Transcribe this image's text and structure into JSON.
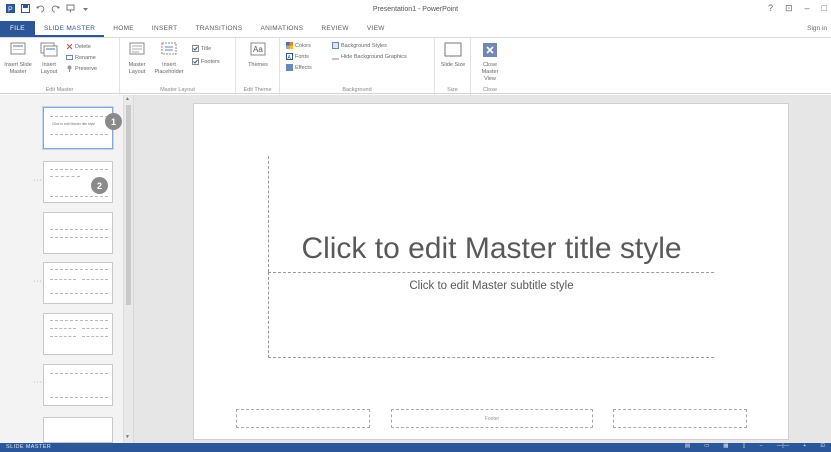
{
  "window": {
    "title": "Presentation1 - PowerPoint",
    "controls": [
      "?",
      "⊡",
      "–",
      "□"
    ]
  },
  "qat": {
    "icons": [
      "powerpoint-logo-icon",
      "save-icon",
      "undo-icon",
      "redo-icon",
      "start-from-beginning-icon",
      "customize-qat-icon"
    ]
  },
  "tabs": {
    "file": "FILE",
    "items": [
      "SLIDE MASTER",
      "HOME",
      "INSERT",
      "TRANSITIONS",
      "ANIMATIONS",
      "REVIEW",
      "VIEW"
    ],
    "active": "SLIDE MASTER",
    "signin": "Sign in"
  },
  "ribbon": {
    "edit_master": {
      "label": "Edit Master",
      "insert_slide_master": "Insert Slide Master",
      "insert_layout": "Insert Layout",
      "delete": "Delete",
      "rename": "Rename",
      "preserve": "Preserve"
    },
    "master_layout": {
      "label": "Master Layout",
      "master_layout": "Master Layout",
      "insert_placeholder": "Insert Placeholder",
      "title": "Title",
      "footers": "Footers"
    },
    "edit_theme": {
      "label": "Edit Theme",
      "themes": "Themes"
    },
    "background": {
      "label": "Background",
      "colors": "Colors",
      "fonts": "Fonts",
      "effects": "Effects",
      "background_styles": "Background Styles",
      "hide_background_graphics": "Hide Background Graphics"
    },
    "size": {
      "label": "Size",
      "slide_size": "Slide Size"
    },
    "close": {
      "label": "Close",
      "close_master_view": "Close Master View"
    }
  },
  "slide_panel": {
    "thumbnails": [
      {
        "index": 1,
        "selected": true,
        "callout": "1"
      },
      {
        "index": 2,
        "selected": false,
        "callout": "2"
      },
      {
        "index": 3,
        "selected": false,
        "callout": ""
      },
      {
        "index": 4,
        "selected": false,
        "callout": ""
      },
      {
        "index": 5,
        "selected": false,
        "callout": ""
      },
      {
        "index": 6,
        "selected": false,
        "callout": ""
      },
      {
        "index": 7,
        "selected": false,
        "callout": ""
      }
    ]
  },
  "slide": {
    "title": "Click to edit Master title style",
    "subtitle": "Click to edit Master subtitle style",
    "footer_date": "",
    "footer_center": "Footer",
    "footer_number": ""
  },
  "status": {
    "left": "SLIDE MASTER",
    "right_items": [
      "notes",
      "normal-view",
      "slide-sorter",
      "reading-view",
      "zoom-out",
      "zoom-slider",
      "zoom-in",
      "fit-slide"
    ]
  },
  "colors": {
    "accent": "#2b579a",
    "panel_bg": "#f3f3f3",
    "edit_bg": "#e6e6e6"
  }
}
